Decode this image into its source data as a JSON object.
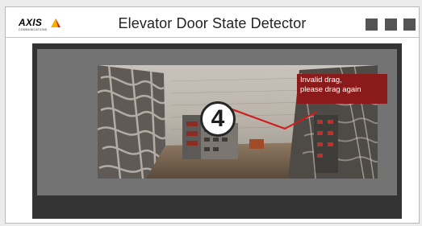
{
  "header": {
    "logo_text": "AXIS",
    "logo_subtext": "COMMUNICATIONS",
    "title": "Elevator Door State Detector"
  },
  "viewer": {
    "step_number": "4",
    "error_message": {
      "line1": "Invalid drag,",
      "line2": "please drag again"
    }
  },
  "colors": {
    "window_control": "#545454",
    "error_callout": "#8b1b1b",
    "drag_line": "#d11a1a",
    "logo_accent": "#f6b100"
  },
  "icons": [
    "axis-logo-icon",
    "window-control-icon",
    "drag-line-icon"
  ]
}
